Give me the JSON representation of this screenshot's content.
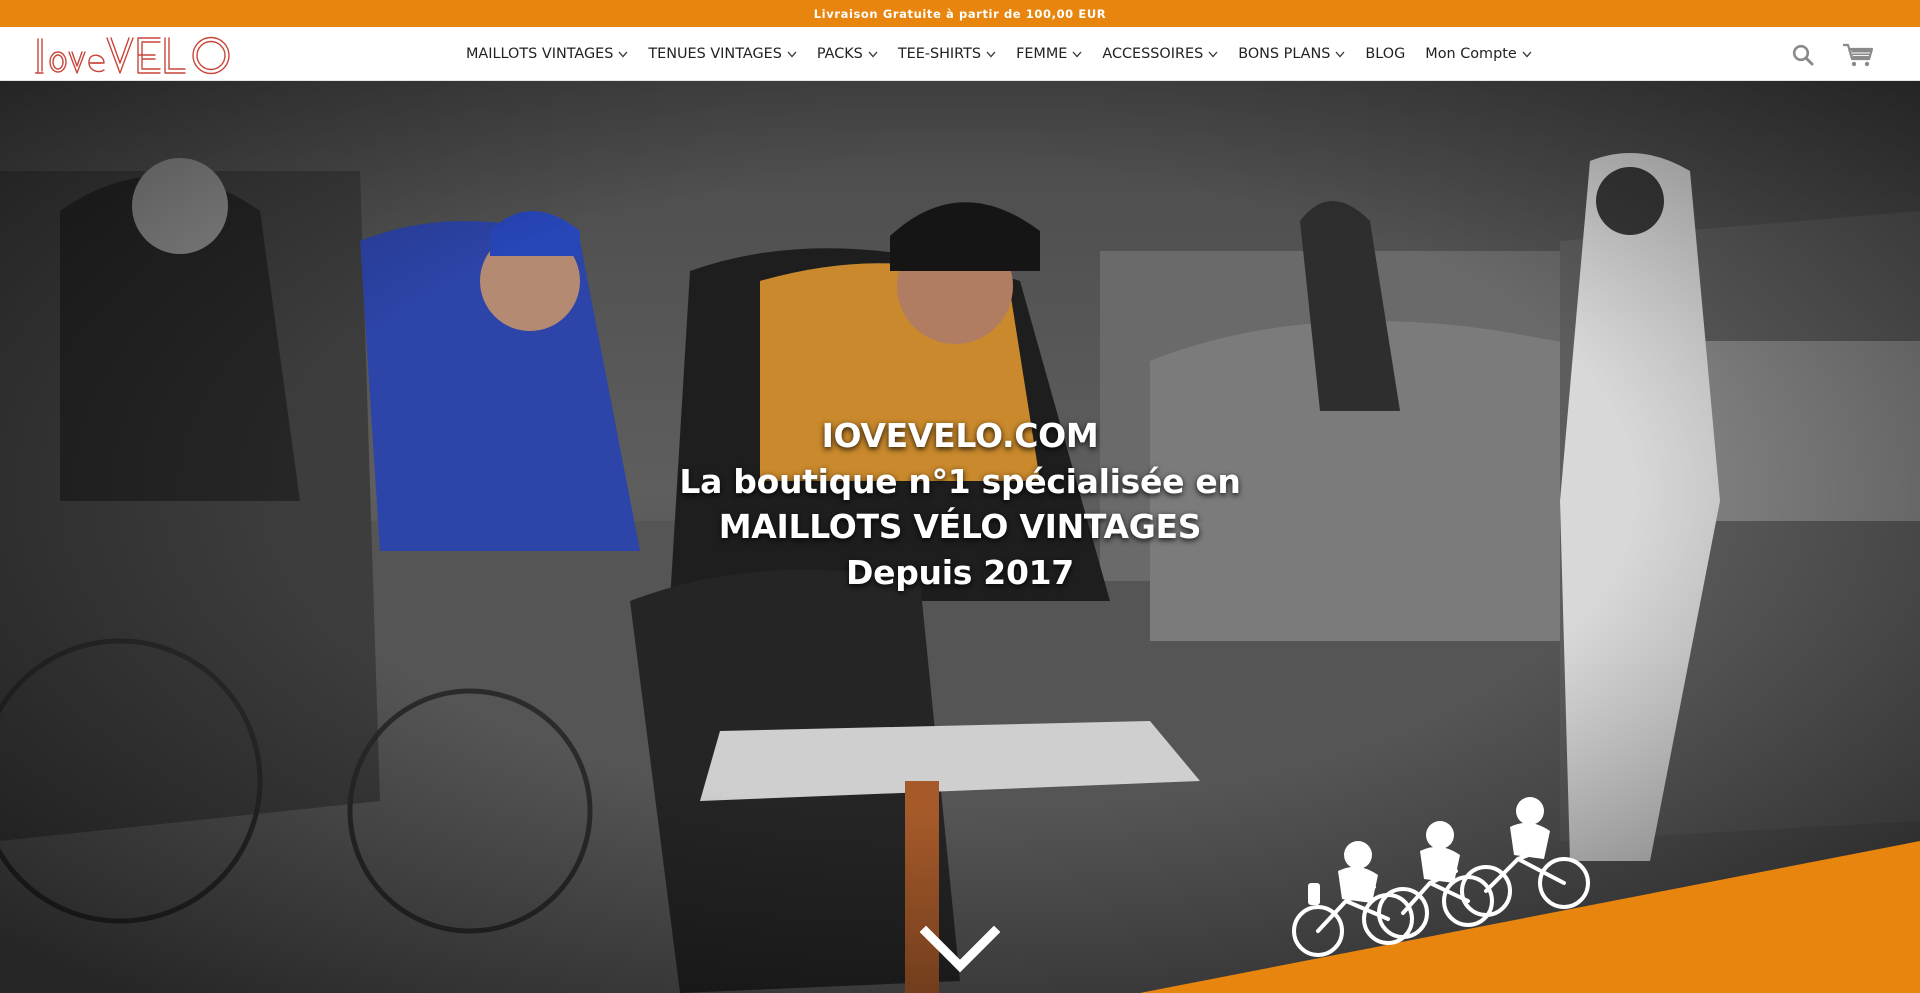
{
  "announcement": {
    "text": "Livraison Gratuite à partir de 100,00 EUR"
  },
  "brand": {
    "name": "loveVELO",
    "accent": "#e8850e",
    "logo_stroke": "#c9463a"
  },
  "nav": {
    "items": [
      {
        "label": "MAILLOTS VINTAGES",
        "has_dropdown": true
      },
      {
        "label": "TENUES VINTAGES",
        "has_dropdown": true
      },
      {
        "label": "PACKS",
        "has_dropdown": true
      },
      {
        "label": "TEE-SHIRTS",
        "has_dropdown": true
      },
      {
        "label": "FEMME",
        "has_dropdown": true
      },
      {
        "label": "ACCESSOIRES",
        "has_dropdown": true
      },
      {
        "label": "BONS PLANS",
        "has_dropdown": true
      },
      {
        "label": "BLOG",
        "has_dropdown": false
      },
      {
        "label": "Mon Compte",
        "has_dropdown": true
      }
    ]
  },
  "header_icons": {
    "search": "search-icon",
    "cart": "cart-icon"
  },
  "hero": {
    "line1": "IOVEVELO.COM",
    "line2": "La boutique n°1 spécialisée en",
    "line3": "MAILLOTS VÉLO VINTAGES",
    "line4": "Depuis 2017",
    "scroll_icon": "chevron-down-icon",
    "decor_icon": "cyclists-icon"
  }
}
